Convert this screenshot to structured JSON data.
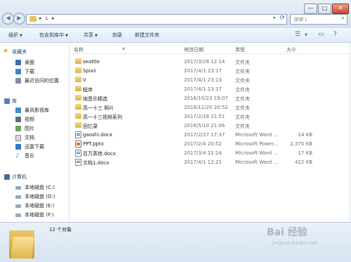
{
  "titlebar": {
    "controls": {
      "minimize": "—",
      "maximize": "□",
      "close": "✕"
    }
  },
  "nav": {
    "back": "◀",
    "forward": "▶"
  },
  "address": {
    "sep1": "▸",
    "path": "L",
    "sep2": "▸",
    "dropdown": "▾",
    "refresh": "⟳"
  },
  "search": {
    "placeholder": "搜索 L",
    "icon": "search-icon"
  },
  "toolbar": {
    "organize": "组织",
    "include_in_library": "包含到库中",
    "share": "共享",
    "burn": "刻录",
    "new_folder": "新建文件夹"
  },
  "sidebar": {
    "favorites": {
      "header": "收藏夹",
      "items": [
        "桌面",
        "下载",
        "最近访问的位置"
      ]
    },
    "libraries": {
      "header": "库",
      "items": [
        "暴风影视库",
        "视频",
        "图片",
        "文档",
        "迅雷下载",
        "音乐"
      ]
    },
    "computer": {
      "header": "计算机",
      "items": [
        "本地磁盘 (C:)",
        "本地磁盘 (D:)",
        "本地磁盘 (E:)",
        "本地磁盘 (F:)"
      ]
    }
  },
  "columns": {
    "name": "名称",
    "modified": "修改日期",
    "type": "类型",
    "size": "大小"
  },
  "files": [
    {
      "name": "seattle",
      "modified": "2017/3/28 12:14",
      "type": "文件夹",
      "size": "",
      "kind": "folder"
    },
    {
      "name": "Spixii",
      "modified": "2017/4/1 23:17",
      "type": "文件夹",
      "size": "",
      "kind": "folder"
    },
    {
      "name": "V",
      "modified": "2017/4/1 23:13",
      "type": "文件夹",
      "size": "",
      "kind": "folder"
    },
    {
      "name": "程序",
      "modified": "2017/4/1 23:17",
      "type": "文件夹",
      "size": "",
      "kind": "folder"
    },
    {
      "name": "纯音乐精选",
      "modified": "2016/10/23 19:07",
      "type": "文件夹",
      "size": "",
      "kind": "folder"
    },
    {
      "name": "高一十三 照片",
      "modified": "2016/11/20 20:52",
      "type": "文件夹",
      "size": "",
      "kind": "folder"
    },
    {
      "name": "高一十三视频系列",
      "modified": "2017/2/18 21:51",
      "type": "文件夹",
      "size": "",
      "kind": "folder"
    },
    {
      "name": "回忆录",
      "modified": "2016/5/10 21:06",
      "type": "文件夹",
      "size": "",
      "kind": "folder"
    },
    {
      "name": "gaoshi.docx",
      "modified": "2017/2/27 17:37",
      "type": "Microsoft Word ...",
      "size": "14 KB",
      "kind": "doc"
    },
    {
      "name": "PPT.pptx",
      "modified": "2017/2/4 20:52",
      "type": "Microsoft Power...",
      "size": "2,375 KB",
      "kind": "ppt"
    },
    {
      "name": "百万英镑.docx",
      "modified": "2017/3/4 21:24",
      "type": "Microsoft Word ...",
      "size": "17 KB",
      "kind": "doc"
    },
    {
      "name": "文档1.docx",
      "modified": "2017/4/1 12:21",
      "type": "Microsoft Word ...",
      "size": "422 KB",
      "kind": "doc"
    }
  ],
  "details": {
    "count": "12 个对象"
  },
  "watermark": {
    "line1": "Bai 经验",
    "line2": "jingyan.baidu.com"
  },
  "colors": {
    "folder": "#e8c060",
    "accent": "#1e3f6e"
  }
}
